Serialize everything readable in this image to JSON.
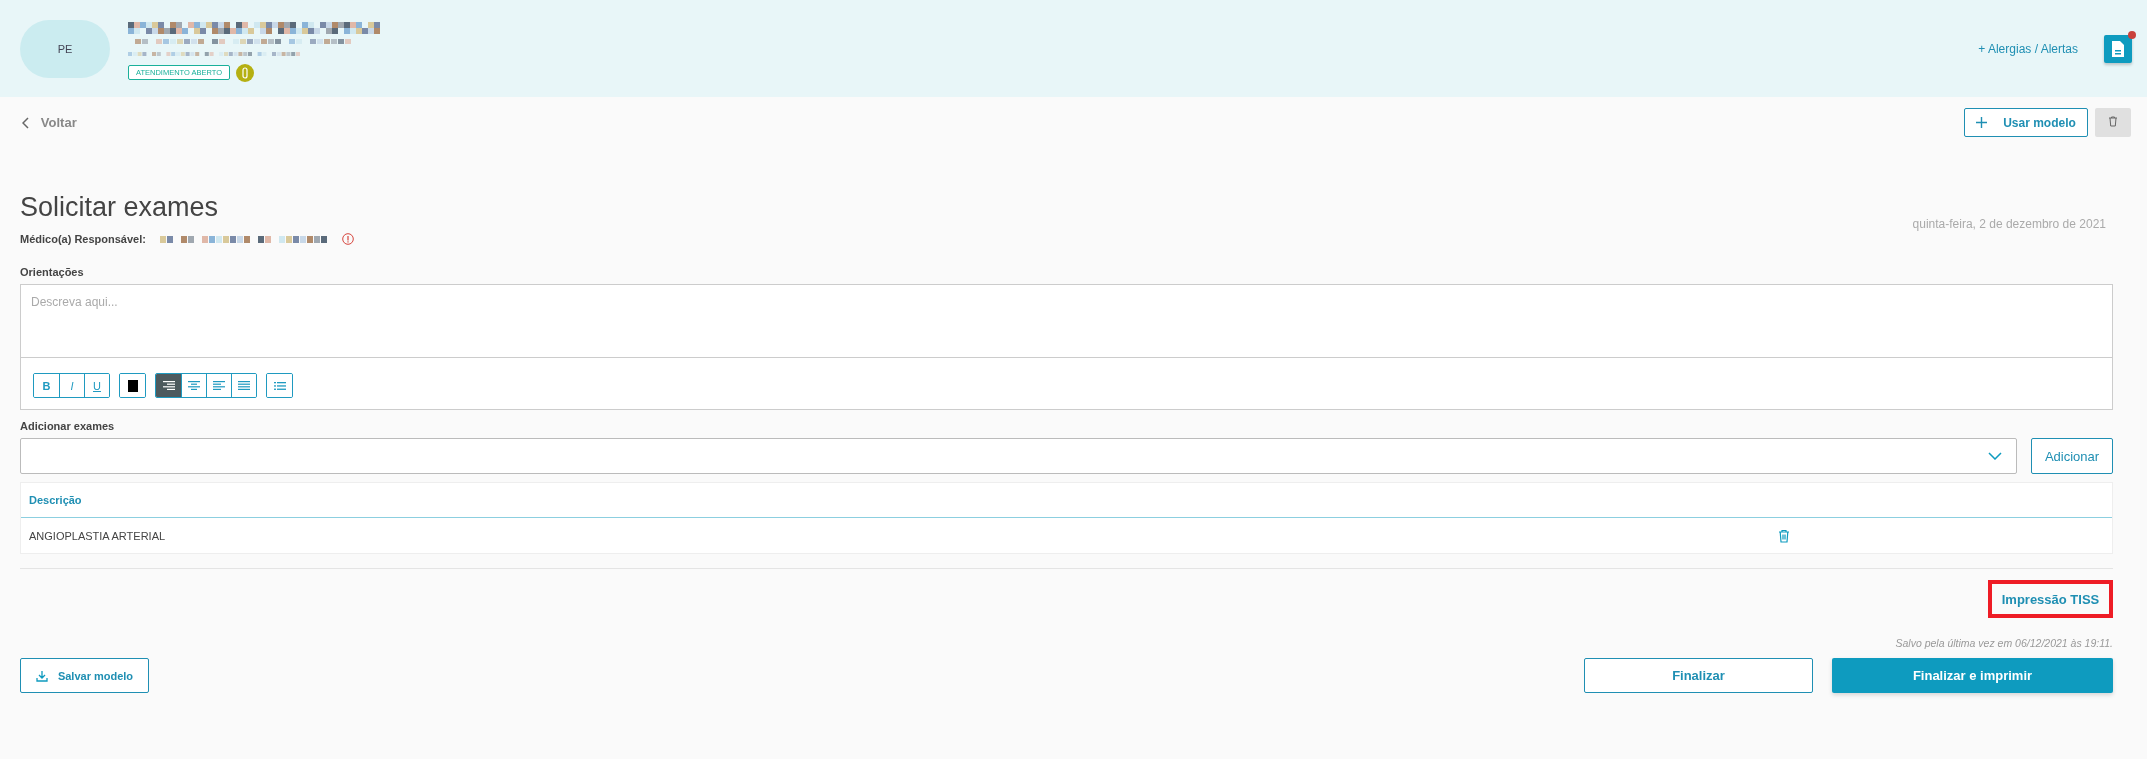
{
  "header": {
    "avatar": "PE",
    "badge": "ATENDIMENTO ABERTO",
    "allergies_link": "+ Alergias / Alertas",
    "document_button": {
      "notification": true
    }
  },
  "nav": {
    "back": "Voltar",
    "use_model": "Usar modelo"
  },
  "form": {
    "title": "Solicitar exames",
    "date": "quinta-feira, 2 de dezembro de 2021",
    "doctor_label": "Médico(a) Responsável:",
    "guidance_label": "Orientações",
    "guidance_placeholder": "Descreva aqui...",
    "format_buttons": [
      {
        "label": "B",
        "kind": "bold"
      },
      {
        "label": "I",
        "kind": "italic"
      },
      {
        "label": "U",
        "kind": "underline"
      }
    ],
    "align_buttons": [
      {
        "kind": "right",
        "selected": true
      },
      {
        "kind": "center",
        "selected": false
      },
      {
        "kind": "left",
        "selected": false
      },
      {
        "kind": "justify",
        "selected": false
      }
    ],
    "exams_label": "Adicionar exames",
    "add_button": "Adicionar",
    "table": {
      "columns": [
        "Descrição"
      ],
      "rows": [
        {
          "description": "ANGIOPLASTIA ARTERIAL"
        }
      ]
    },
    "tiss_button": "Impressão TISS",
    "saved_note": "Salvo pela última vez em 06/12/2021 às 19:11.",
    "save_model": "Salvar modelo",
    "finish": "Finalizar",
    "finish_print": "Finalizar e imprimir"
  }
}
